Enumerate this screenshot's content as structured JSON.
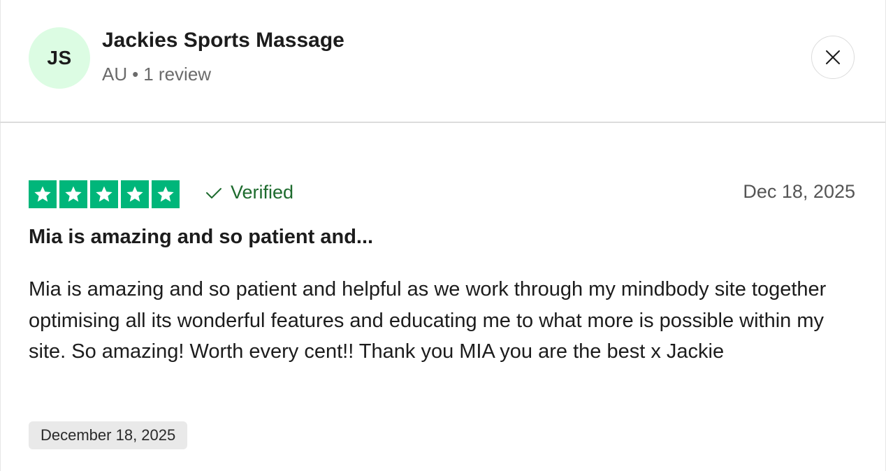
{
  "reviewer": {
    "initials": "JS",
    "name": "Jackies Sports Massage",
    "country": "AU",
    "separator": "•",
    "review_count": "1 review",
    "avatar_color": "#dcfce3"
  },
  "review": {
    "rating": 5,
    "rating_max": 5,
    "star_color": "#00b67a",
    "verified_label": "Verified",
    "verified_color": "#1e6b2e",
    "date": "Dec 18, 2025",
    "title": "Mia is amazing and so patient and...",
    "text": "Mia is amazing and so patient and helpful as we work through my mindbody site together optimising all its wonderful features and educating me to what more is possible within my site. So amazing! Worth every cent!! Thank you MIA you are the best x Jackie",
    "experience_date": "December 18, 2025"
  },
  "icons": {
    "close": "close-icon",
    "check": "check-icon",
    "star": "star-icon"
  }
}
